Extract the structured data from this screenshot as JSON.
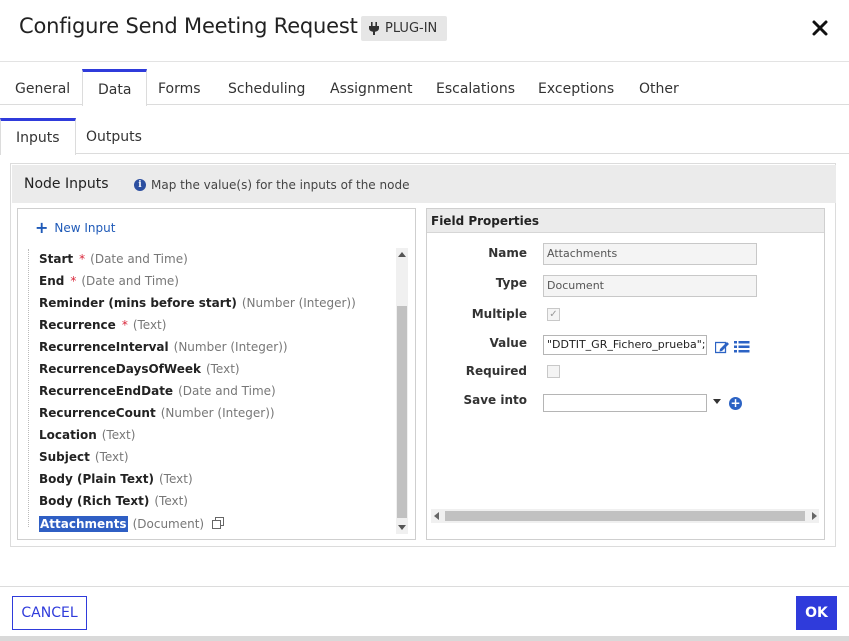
{
  "dialog": {
    "title": "Configure Send Meeting Request",
    "badge": "PLUG-IN"
  },
  "tabs": [
    {
      "label": "General"
    },
    {
      "label": "Data"
    },
    {
      "label": "Forms"
    },
    {
      "label": "Scheduling"
    },
    {
      "label": "Assignment"
    },
    {
      "label": "Escalations"
    },
    {
      "label": "Exceptions"
    },
    {
      "label": "Other"
    }
  ],
  "active_tab": "Data",
  "subtabs": [
    {
      "label": "Inputs"
    },
    {
      "label": "Outputs"
    }
  ],
  "active_subtab": "Inputs",
  "panel": {
    "title": "Node Inputs",
    "hint": "Map the value(s) for the inputs of the node"
  },
  "inputs": {
    "new_input_label": "New Input",
    "items": [
      {
        "name": "Start",
        "required": "*",
        "type": "(Date and Time)"
      },
      {
        "name": "End",
        "required": "*",
        "type": "(Date and Time)"
      },
      {
        "name": "Reminder (mins before start)",
        "required": "",
        "type": "(Number (Integer))"
      },
      {
        "name": "Recurrence",
        "required": "*",
        "type": "(Text)"
      },
      {
        "name": "RecurrenceInterval",
        "required": "",
        "type": "(Number (Integer))"
      },
      {
        "name": "RecurrenceDaysOfWeek",
        "required": "",
        "type": "(Text)"
      },
      {
        "name": "RecurrenceEndDate",
        "required": "",
        "type": "(Date and Time)"
      },
      {
        "name": "RecurrenceCount",
        "required": "",
        "type": "(Number (Integer))"
      },
      {
        "name": "Location",
        "required": "",
        "type": "(Text)"
      },
      {
        "name": "Subject",
        "required": "",
        "type": "(Text)"
      },
      {
        "name": "Body (Plain Text)",
        "required": "",
        "type": "(Text)"
      },
      {
        "name": "Body (Rich Text)",
        "required": "",
        "type": "(Text)"
      },
      {
        "name": "Attachments",
        "required": "",
        "type": "(Document)"
      }
    ],
    "selected": "Attachments"
  },
  "field_properties": {
    "header": "Field Properties",
    "name_label": "Name",
    "name_value": "Attachments",
    "type_label": "Type",
    "type_value": "Document",
    "multiple_label": "Multiple",
    "multiple_checked": true,
    "value_label": "Value",
    "value_value": "\"DDTIT_GR_Fichero_prueba\";",
    "required_label": "Required",
    "required_checked": false,
    "save_into_label": "Save into",
    "save_into_value": ""
  },
  "footer": {
    "cancel_label": "CANCEL",
    "ok_label": "OK"
  },
  "colors": {
    "accent": "#2f3bdb",
    "link": "#1f5ab8",
    "required": "#d9263a",
    "selection": "#2f5fc4"
  }
}
